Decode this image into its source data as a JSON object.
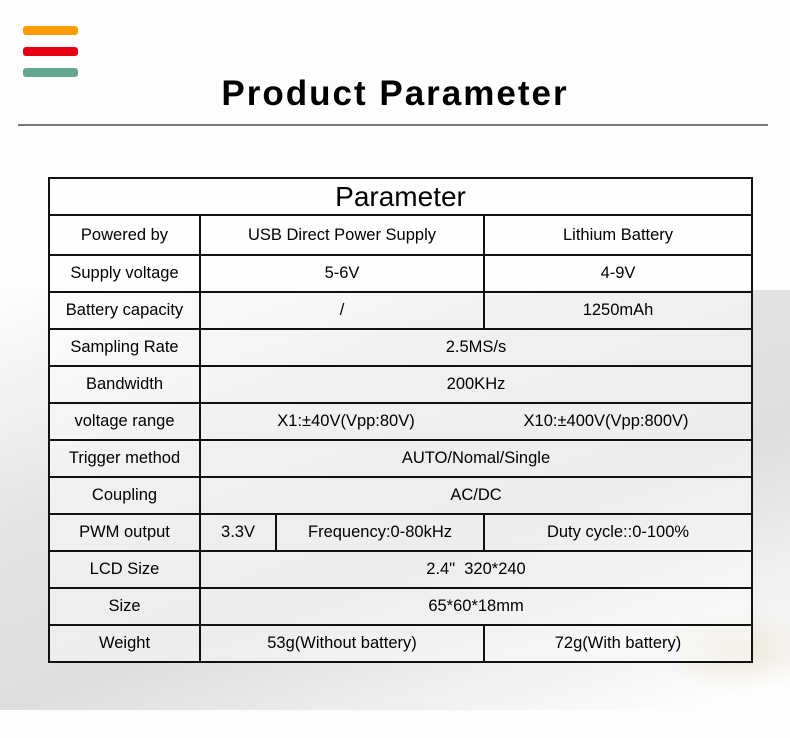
{
  "header": {
    "title": "Product Parameter",
    "stripe_colors": [
      "#ff9c00",
      "#e60013",
      "#64a68e"
    ]
  },
  "table": {
    "title": "Parameter",
    "rows": {
      "powered_by": {
        "label": "Powered by",
        "usb": "USB Direct Power Supply",
        "battery": "Lithium Battery"
      },
      "supply_voltage": {
        "label": "Supply voltage",
        "usb": "5-6V",
        "battery": "4-9V"
      },
      "battery_capacity": {
        "label": "Battery capacity",
        "usb": "/",
        "battery": "1250mAh"
      },
      "sampling_rate": {
        "label": "Sampling Rate",
        "value": "2.5MS/s"
      },
      "bandwidth": {
        "label": "Bandwidth",
        "value": "200KHz"
      },
      "voltage_range": {
        "label": "voltage range",
        "x1": "X1:±40V(Vpp:80V)",
        "x10": "X10:±400V(Vpp:800V)"
      },
      "trigger_method": {
        "label": "Trigger method",
        "value": "AUTO/Nomal/Single"
      },
      "coupling": {
        "label": "Coupling",
        "value": "AC/DC"
      },
      "pwm_output": {
        "label": "PWM output",
        "voltage": "3.3V",
        "frequency": "Frequency:0-80kHz",
        "duty": "Duty cycle::0-100%"
      },
      "lcd_size": {
        "label": "LCD Size",
        "value": "2.4\"  320*240"
      },
      "size": {
        "label": "Size",
        "value": "65*60*18mm"
      },
      "weight": {
        "label": "Weight",
        "without_battery": "53g(Without battery)",
        "with_battery": "72g(With battery)"
      }
    }
  }
}
